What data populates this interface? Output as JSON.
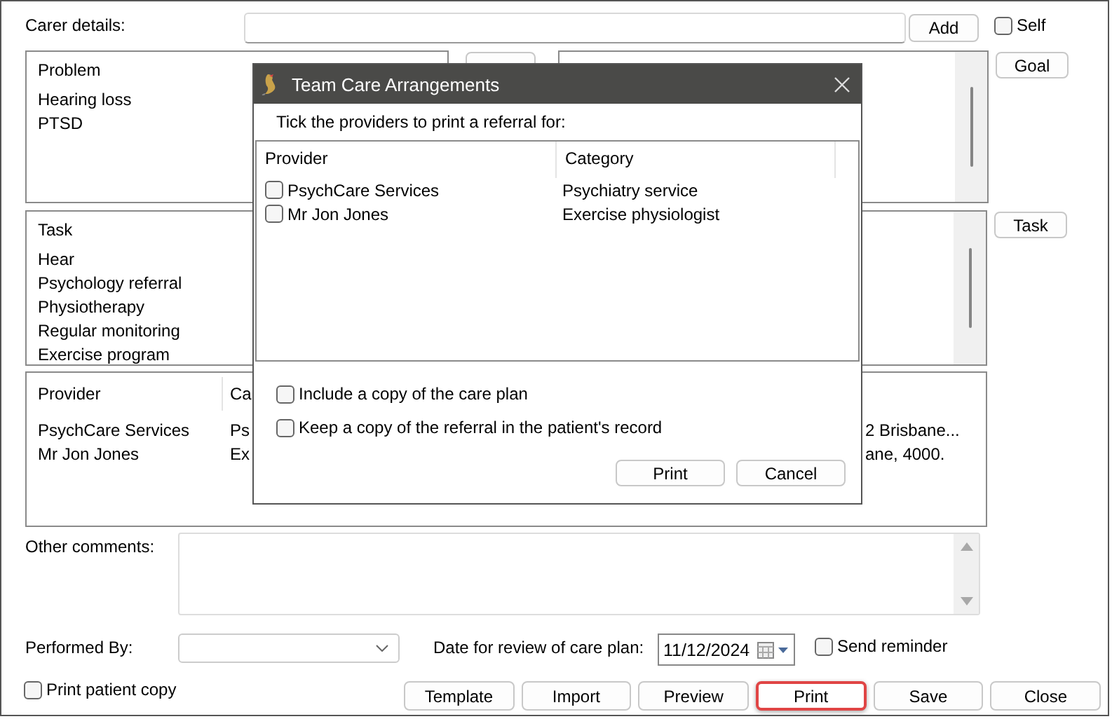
{
  "carer": {
    "label": "Carer details:",
    "add_button": "Add",
    "self": {
      "label": "Self",
      "checked": false
    }
  },
  "problems": {
    "header": "Problem",
    "items": [
      "Hearing loss",
      "PTSD"
    ]
  },
  "goal_button": "Goal",
  "tasks": {
    "header": "Task",
    "items": [
      "Hear",
      "Psychology referral",
      "Physiotherapy",
      "Regular monitoring",
      "Exercise program"
    ]
  },
  "task_button": "Task",
  "providers": {
    "columns": [
      "Provider",
      "Ca"
    ],
    "rows": [
      [
        "PsychCare Services",
        "Ps",
        "2 Brisbane..."
      ],
      [
        "Mr Jon Jones",
        "Ex",
        "ane, 4000."
      ]
    ]
  },
  "comments": {
    "label": "Other comments:"
  },
  "performed_by": {
    "label": "Performed By:"
  },
  "review_date": {
    "label": "Date for review of care plan:",
    "value": "11/12/2024"
  },
  "send_reminder": {
    "label": "Send reminder",
    "checked": false
  },
  "print_patient_copy": {
    "label": "Print patient copy",
    "checked": false
  },
  "buttons": [
    {
      "label": "Template",
      "highlighted": false
    },
    {
      "label": "Import",
      "highlighted": false
    },
    {
      "label": "Preview",
      "highlighted": false
    },
    {
      "label": "Print",
      "highlighted": true
    },
    {
      "label": "Save",
      "highlighted": false
    },
    {
      "label": "Close",
      "highlighted": false
    }
  ],
  "dialog": {
    "title": "Team Care Arrangements",
    "instruction": "Tick the providers to print a referral for:",
    "columns": [
      "Provider",
      "Category"
    ],
    "rows": [
      {
        "provider": "PsychCare Services",
        "category": "Psychiatry service",
        "checked": false
      },
      {
        "provider": "Mr Jon Jones",
        "category": "Exercise physiologist",
        "checked": false
      }
    ],
    "options": [
      {
        "label": "Include a copy of the care plan",
        "checked": false
      },
      {
        "label": "Keep a copy of the referral in the patient's record",
        "checked": false
      }
    ],
    "buttons": [
      "Print",
      "Cancel"
    ]
  }
}
